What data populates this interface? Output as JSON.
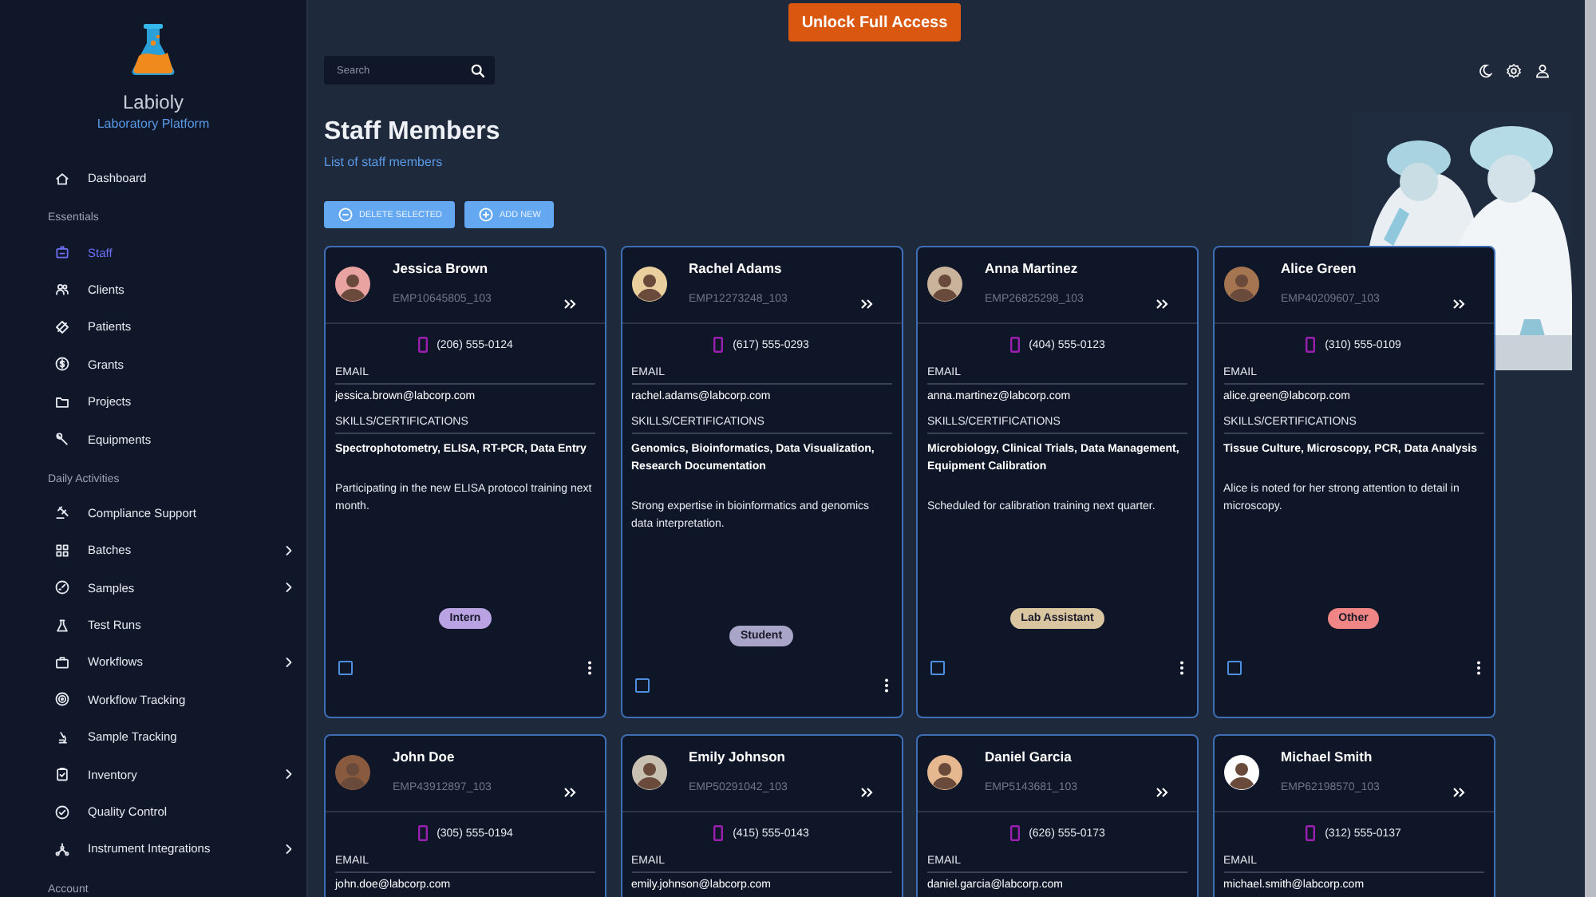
{
  "brand": {
    "name": "Labioly",
    "tagline": "Laboratory Platform"
  },
  "sidebar": {
    "items": [
      {
        "kind": "item",
        "label": "Dashboard",
        "selected": false,
        "expandable": false
      },
      {
        "kind": "section",
        "label": "Essentials"
      },
      {
        "kind": "item",
        "label": "Staff",
        "selected": true,
        "expandable": false
      },
      {
        "kind": "item",
        "label": "Clients",
        "selected": false,
        "expandable": false
      },
      {
        "kind": "item",
        "label": "Patients",
        "selected": false,
        "expandable": false
      },
      {
        "kind": "item",
        "label": "Grants",
        "selected": false,
        "expandable": false
      },
      {
        "kind": "item",
        "label": "Projects",
        "selected": false,
        "expandable": false
      },
      {
        "kind": "item",
        "label": "Equipments",
        "selected": false,
        "expandable": false
      },
      {
        "kind": "section",
        "label": "Daily Activities"
      },
      {
        "kind": "item",
        "label": "Compliance Support",
        "selected": false,
        "expandable": false
      },
      {
        "kind": "item",
        "label": "Batches",
        "selected": false,
        "expandable": true
      },
      {
        "kind": "item",
        "label": "Samples",
        "selected": false,
        "expandable": true
      },
      {
        "kind": "item",
        "label": "Test Runs",
        "selected": false,
        "expandable": false
      },
      {
        "kind": "item",
        "label": "Workflows",
        "selected": false,
        "expandable": true
      },
      {
        "kind": "item",
        "label": "Workflow Tracking",
        "selected": false,
        "expandable": false
      },
      {
        "kind": "item",
        "label": "Sample Tracking",
        "selected": false,
        "expandable": false
      },
      {
        "kind": "item",
        "label": "Inventory",
        "selected": false,
        "expandable": true
      },
      {
        "kind": "item",
        "label": "Quality Control",
        "selected": false,
        "expandable": false
      },
      {
        "kind": "item",
        "label": "Instrument Integrations",
        "selected": false,
        "expandable": true
      },
      {
        "kind": "section",
        "label": "Account"
      }
    ]
  },
  "top_button": "Unlock Full Access",
  "search": {
    "placeholder": "Search"
  },
  "page": {
    "title": "Staff Members",
    "subtitle": "List of staff members",
    "actions": [
      "DELETE SELECTED",
      "ADD NEW"
    ]
  },
  "staff": [
    {
      "name": "Jessica Brown",
      "id": "EMP10645805_103",
      "phone": "(206) 555-0124",
      "email_label": "EMAIL",
      "email": "jessica.brown@labcorp.com",
      "skills_label": "SKILLS/CERTIFICATIONS",
      "skills": "Spectrophotometry, ELISA, RT-PCR, Data Entry",
      "note": "Participating in the new ELISA protocol training next month.",
      "role": "Intern",
      "color": "#b9a3e3",
      "checked": false
    },
    {
      "name": "Rachel Adams",
      "id": "EMP12273248_103",
      "phone": "(617) 555-0293",
      "email_label": "EMAIL",
      "email": "rachel.adams@labcorp.com",
      "skills_label": "SKILLS/CERTIFICATIONS",
      "skills": "Genomics, Bioinformatics, Data Visualization, Research Documentation",
      "note": "Strong expertise in bioinformatics and genomics data interpretation.",
      "role": "Student",
      "color": "#a8a5c8",
      "checked": false
    },
    {
      "name": "Anna Martinez",
      "id": "EMP26825298_103",
      "phone": "(404) 555-0123",
      "email_label": "EMAIL",
      "email": "anna.martinez@labcorp.com",
      "skills_label": "SKILLS/CERTIFICATIONS",
      "skills": "Microbiology, Clinical Trials, Data Management, Equipment Calibration",
      "note": "Scheduled for calibration training next quarter.",
      "role": "Lab Assistant",
      "color": "#d9c5a0",
      "checked": false
    },
    {
      "name": "Alice Green",
      "id": "EMP40209607_103",
      "phone": "(310) 555-0109",
      "email_label": "EMAIL",
      "email": "alice.green@labcorp.com",
      "skills_label": "SKILLS/CERTIFICATIONS",
      "skills": "Tissue Culture, Microscopy, PCR, Data Analysis",
      "note": "Alice is noted for her strong attention to detail in microscopy.",
      "role": "Other",
      "color": "#f08585",
      "checked": false
    },
    {
      "name": "John Doe",
      "id": "EMP43912897_103",
      "phone": "(305) 555-0194",
      "email_label": "EMAIL",
      "email": "john.doe@labcorp.com"
    },
    {
      "name": "Emily Johnson",
      "id": "EMP50291042_103",
      "phone": "(415) 555-0143",
      "email_label": "EMAIL",
      "email": "emily.johnson@labcorp.com"
    },
    {
      "name": "Daniel Garcia",
      "id": "EMP5143681_103",
      "phone": "(626) 555-0173",
      "email_label": "EMAIL",
      "email": "daniel.garcia@labcorp.com"
    },
    {
      "name": "Michael Smith",
      "id": "EMP62198570_103",
      "phone": "(312) 555-0137",
      "email_label": "EMAIL",
      "email": "michael.smith@labcorp.com"
    }
  ]
}
